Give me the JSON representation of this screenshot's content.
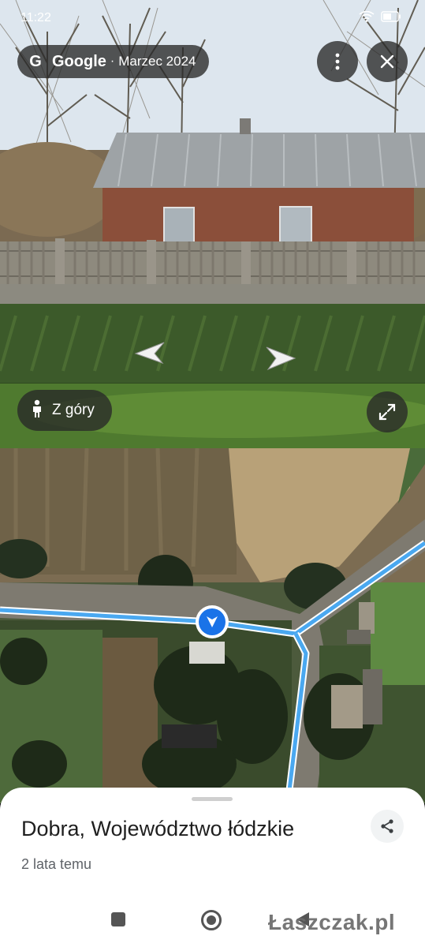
{
  "status_bar": {
    "time": "11:22",
    "tiktok_icon": "tiktok-icon",
    "right_icons": [
      "wifi-icon",
      "battery-icon"
    ]
  },
  "street_view": {
    "brand": "Google",
    "separator": "·",
    "capture_date": "Marzec 2024",
    "menu_icon": "more-vert-icon",
    "close_icon": "close-icon",
    "above_label": "Z góry",
    "above_icon": "pegman-icon",
    "expand_icon": "fullscreen-icon",
    "nav_arrows": [
      "arrow-left-icon",
      "arrow-right-icon"
    ]
  },
  "map": {
    "route_color": "#4aa8f0",
    "marker_color": "#1a73e8",
    "marker_icon": "navigation-arrow-icon"
  },
  "sheet": {
    "title": "Dobra, Województwo łódzkie",
    "subtitle": "2 lata temu",
    "share_icon": "share-icon"
  },
  "system_nav": {
    "recents_icon": "square-icon",
    "home_icon": "circle-icon",
    "back_icon": "back-triangle-icon"
  },
  "watermark": "Łaszczak.pl"
}
